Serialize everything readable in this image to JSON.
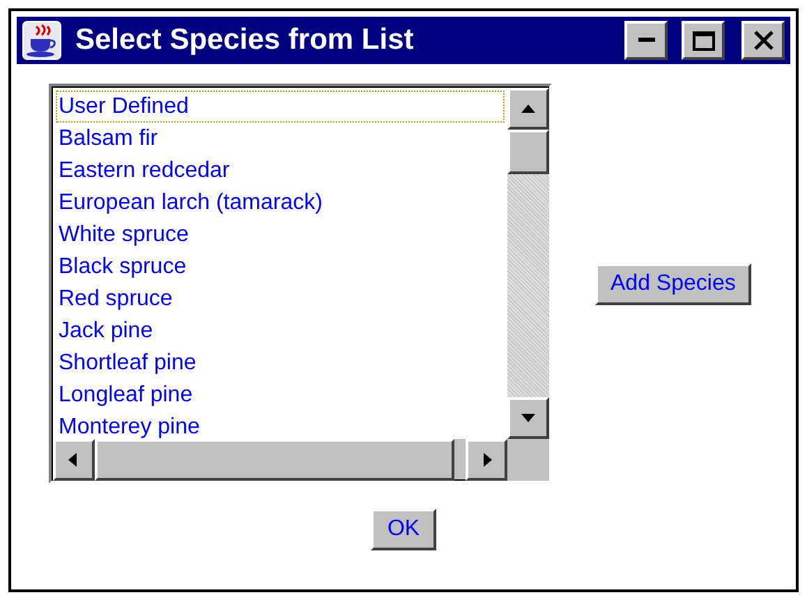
{
  "window": {
    "title": "Select Species from List"
  },
  "species_list": [
    {
      "label": "User Defined",
      "focused": true
    },
    {
      "label": "Balsam fir",
      "focused": false
    },
    {
      "label": "Eastern redcedar",
      "focused": false
    },
    {
      "label": "European larch (tamarack)",
      "focused": false
    },
    {
      "label": "White spruce",
      "focused": false
    },
    {
      "label": "Black spruce",
      "focused": false
    },
    {
      "label": "Red spruce",
      "focused": false
    },
    {
      "label": "Jack pine",
      "focused": false
    },
    {
      "label": "Shortleaf pine",
      "focused": false
    },
    {
      "label": "Longleaf pine",
      "focused": false
    },
    {
      "label": "Monterey pine",
      "focused": false
    }
  ],
  "buttons": [
    {
      "kind": "add",
      "label": "Add Species"
    },
    {
      "kind": "ok",
      "label": "OK"
    }
  ]
}
